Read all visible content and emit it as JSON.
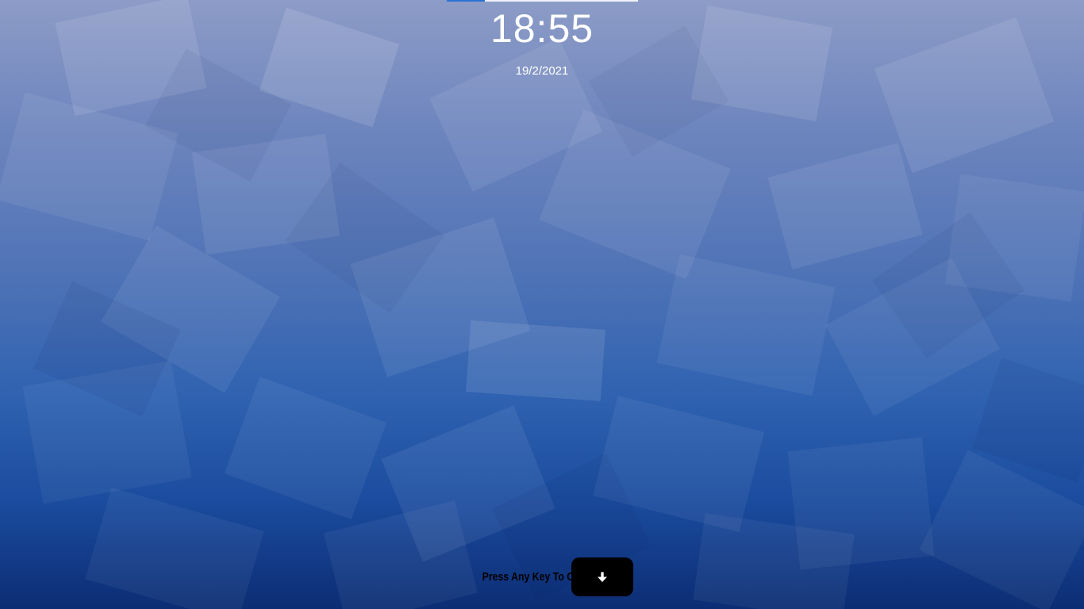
{
  "lock_screen": {
    "time": "18:55",
    "date": "19/2/2021",
    "prompt": "Press Any Key To Open",
    "unlock_icon": "arrow-down-icon",
    "loading_progress": 0.2
  },
  "colors": {
    "background_top": "#8d9cc7",
    "background_bottom": "#0c2d74",
    "text": "#ffffff",
    "button": "#000000",
    "progress_fill": "#2a73d6",
    "progress_track": "#eef1f8"
  }
}
